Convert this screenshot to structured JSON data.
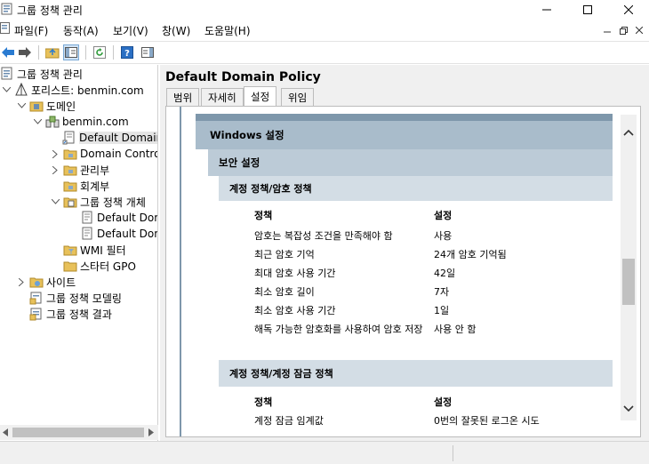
{
  "window": {
    "title": "그룹 정책 관리",
    "min_icon": "minimize-icon",
    "max_icon": "maximize-icon",
    "close_icon": "close-icon"
  },
  "menu": {
    "items": [
      "파일(F)",
      "동작(A)",
      "보기(V)",
      "창(W)",
      "도움말(H)"
    ]
  },
  "tree": {
    "items": [
      {
        "label": "그룹 정책 관리"
      },
      {
        "label": "포리스트: benmin.com"
      },
      {
        "label": "도메인"
      },
      {
        "label": "benmin.com"
      },
      {
        "label": "Default Domain Policy"
      },
      {
        "label": "Domain Controllers"
      },
      {
        "label": "관리부"
      },
      {
        "label": "회계부"
      },
      {
        "label": "그룹 정책 개체"
      },
      {
        "label": "Default Domain Policy"
      },
      {
        "label": "Default Domain Controllers Policy"
      },
      {
        "label": "WMI 필터"
      },
      {
        "label": "스타터 GPO"
      },
      {
        "label": "사이트"
      },
      {
        "label": "그룹 정책 모델링"
      },
      {
        "label": "그룹 정책 결과"
      }
    ]
  },
  "details": {
    "title": "Default Domain Policy",
    "tabs": [
      "범위",
      "자세히",
      "설정",
      "위임"
    ],
    "active_tab": "설정"
  },
  "report": {
    "section1": "Windows 설정",
    "section2": "보안 설정",
    "group1": {
      "title": "계정 정책/암호 정책",
      "col_policy": "정책",
      "col_setting": "설정",
      "rows": [
        {
          "policy": "암호는 복잡성 조건을 만족해야 함",
          "setting": "사용"
        },
        {
          "policy": "최근 암호 기억",
          "setting": "24개 암호 기억됨"
        },
        {
          "policy": "최대 암호 사용 기간",
          "setting": "42일"
        },
        {
          "policy": "최소 암호 길이",
          "setting": "7자"
        },
        {
          "policy": "최소 암호 사용 기간",
          "setting": "1일"
        },
        {
          "policy": "해독 가능한 암호화를 사용하여 암호 저장",
          "setting": "사용 안 함"
        }
      ]
    },
    "group2": {
      "title": "계정 정책/계정 잠금 정책",
      "col_policy": "정책",
      "col_setting": "설정",
      "rows": [
        {
          "policy": "계정 잠금 임계값",
          "setting": "0번의 잘못된 로그온 시도"
        }
      ]
    }
  },
  "colors": {
    "band_dark": "#a9bccb",
    "band_mid": "#bccbd7",
    "band_light": "#d3dde5",
    "header_strip": "#7e97ab"
  }
}
